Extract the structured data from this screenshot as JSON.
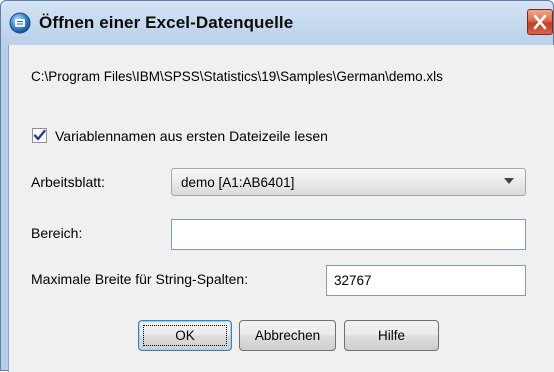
{
  "window": {
    "title": "Öffnen einer Excel-Datenquelle",
    "icon": "spss-globe-icon",
    "close_icon": "close-x-icon",
    "close_color": "#d3543a"
  },
  "dialog": {
    "file_path": "C:\\Program Files\\IBM\\SPSS\\Statistics\\19\\Samples\\German\\demo.xls",
    "read_variable_names": {
      "label": "Variablennamen aus ersten Dateizeile lesen",
      "checked": true
    },
    "worksheet": {
      "label": "Arbeitsblatt:",
      "selected": "demo [A1:AB6401]"
    },
    "range": {
      "label": "Bereich:",
      "value": ""
    },
    "max_string_width": {
      "label": "Maximale Breite für String-Spalten:",
      "value": "32767"
    }
  },
  "buttons": {
    "ok": "OK",
    "cancel": "Abbrechen",
    "help": "Hilfe"
  }
}
